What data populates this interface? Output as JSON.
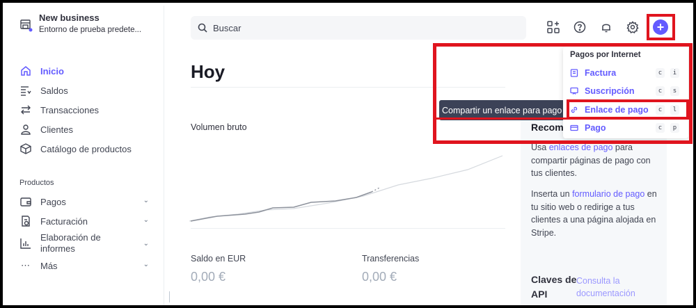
{
  "account": {
    "business_name": "New business",
    "environment": "Entorno de prueba predete..."
  },
  "sidebar": {
    "nav": [
      {
        "label": "Inicio",
        "icon": "home-icon",
        "active": true
      },
      {
        "label": "Saldos",
        "icon": "balances-icon"
      },
      {
        "label": "Transacciones",
        "icon": "transactions-icon"
      },
      {
        "label": "Clientes",
        "icon": "customers-icon"
      },
      {
        "label": "Catálogo de productos",
        "icon": "product-catalog-icon"
      }
    ],
    "section_label": "Productos",
    "products": [
      {
        "label": "Pagos",
        "icon": "payments-icon"
      },
      {
        "label": "Facturación",
        "icon": "billing-icon"
      },
      {
        "label": "Elaboración de informes",
        "icon": "reports-icon"
      },
      {
        "label": "Más",
        "icon": "more-icon"
      }
    ]
  },
  "search": {
    "placeholder": "Buscar"
  },
  "top_icons": [
    "apps-add-icon",
    "help-icon",
    "bell-icon",
    "gear-icon",
    "plus-icon"
  ],
  "main": {
    "title": "Hoy",
    "gross_volume_label": "Volumen bruto",
    "metrics": [
      {
        "label": "Saldo en EUR",
        "value": "0,00 €"
      },
      {
        "label": "Transferencias",
        "value": "0,00 €"
      }
    ]
  },
  "right_panel": {
    "heading": "Recom",
    "p1_pre": "Usa ",
    "p1_link": "enlaces de pago",
    "p1_post": " para compartir páginas de pago con tus clientes.",
    "p2_pre": "Inserta un ",
    "p2_link": "formulario de pago",
    "p2_post": " en tu sitio web o redirige a tus clientes a una página alojada en Stripe.",
    "api_keys_heading": "Claves de API",
    "docs_link": "Consulta la documentación"
  },
  "tooltip": "Compartir un enlace para pago",
  "dropdown": {
    "heading": "Pagos por Internet",
    "items": [
      {
        "label": "Factura",
        "icon": "invoice-icon",
        "keys": [
          "c",
          "i"
        ]
      },
      {
        "label": "Suscripción",
        "icon": "subscription-icon",
        "keys": [
          "c",
          "s"
        ]
      },
      {
        "label": "Enlace de pago",
        "icon": "link-icon",
        "keys": [
          "c",
          "l"
        ]
      },
      {
        "label": "Pago",
        "icon": "payment-card-icon",
        "keys": [
          "c",
          "p"
        ]
      }
    ]
  },
  "colors": {
    "accent": "#635bff",
    "highlight": "#e0141e",
    "tooltip_bg": "#3c4257"
  }
}
